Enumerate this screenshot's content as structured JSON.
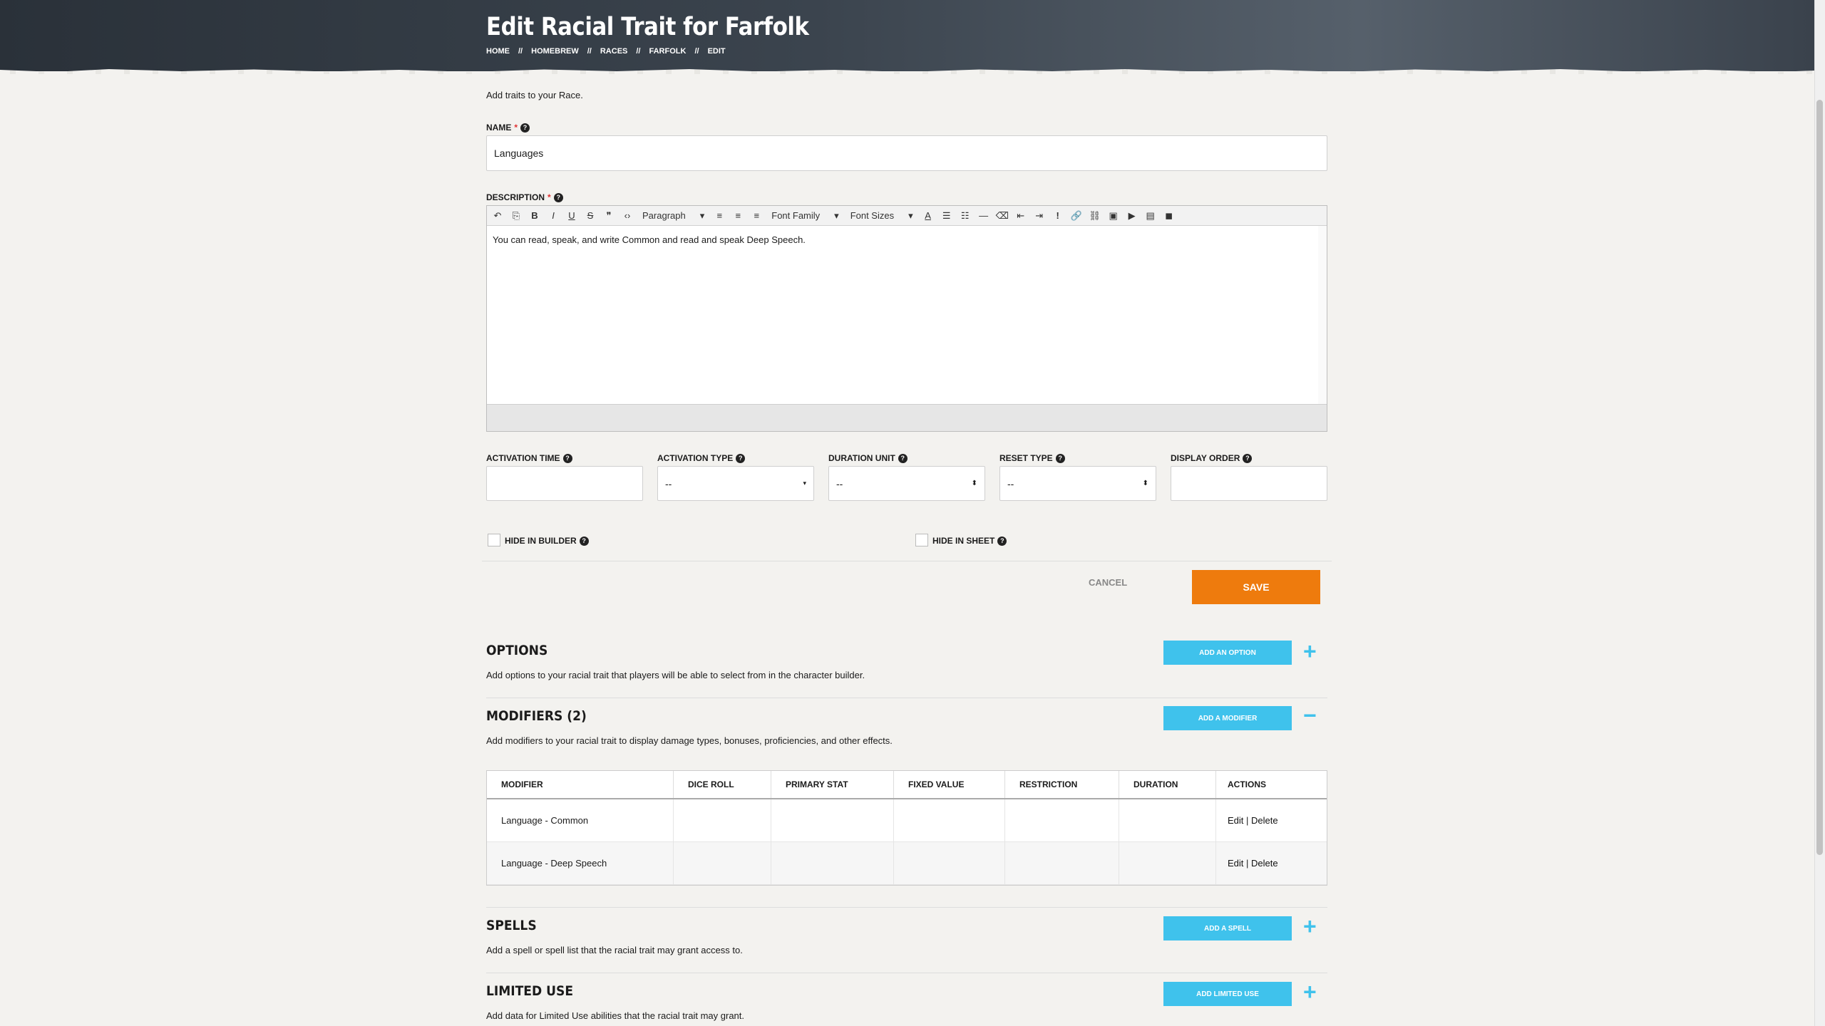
{
  "header": {
    "title": "Edit Racial Trait for Farfolk",
    "breadcrumb": [
      "HOME",
      "//",
      "HOMEBREW",
      "//",
      "RACES",
      "//",
      "FARFOLK",
      "//",
      "EDIT"
    ]
  },
  "intro": "Add traits to your Race.",
  "fields": {
    "name_label": "NAME",
    "name_value": "Languages",
    "description_label": "DESCRIPTION",
    "description_value": "You can read, speak, and write Common and read and speak Deep Speech.",
    "toolbar": {
      "paragraph": "Paragraph",
      "font_family": "Font Family",
      "font_sizes": "Font Sizes"
    },
    "activation_time_label": "ACTIVATION TIME",
    "activation_type_label": "ACTIVATION TYPE",
    "activation_type_value": "--",
    "duration_unit_label": "DURATION UNIT",
    "duration_unit_value": "--",
    "reset_type_label": "RESET TYPE",
    "reset_type_value": "--",
    "display_order_label": "DISPLAY ORDER",
    "hide_in_builder": "HIDE IN BUILDER",
    "hide_in_sheet": "HIDE IN SHEET"
  },
  "actions": {
    "cancel": "CANCEL",
    "save": "SAVE"
  },
  "sections": {
    "options": {
      "title": "OPTIONS",
      "desc": "Add options to your racial trait that players will be able to select from in the character builder.",
      "button": "ADD AN OPTION",
      "toggle": "+"
    },
    "modifiers": {
      "title": "MODIFIERS (2)",
      "desc": "Add modifiers to your racial trait to display damage types, bonuses, proficiencies, and other effects.",
      "button": "ADD A MODIFIER",
      "toggle": "−"
    },
    "spells": {
      "title": "SPELLS",
      "desc": "Add a spell or spell list that the racial trait may grant access to.",
      "button": "ADD A SPELL",
      "toggle": "+"
    },
    "limited_use": {
      "title": "LIMITED USE",
      "desc": "Add data for Limited Use abilities that the racial trait may grant.",
      "button": "ADD LIMITED USE",
      "toggle": "+"
    }
  },
  "modifiers_table": {
    "columns": [
      "MODIFIER",
      "DICE ROLL",
      "PRIMARY STAT",
      "FIXED VALUE",
      "RESTRICTION",
      "DURATION",
      "ACTIONS"
    ],
    "rows": [
      {
        "modifier": "Language - Common",
        "edit": "Edit",
        "sep": " | ",
        "delete": "Delete"
      },
      {
        "modifier": "Language - Deep Speech",
        "edit": "Edit",
        "sep": " | ",
        "delete": "Delete"
      }
    ]
  },
  "colors": {
    "save": "#ee7b0d",
    "accent_blue": "#3fc2ec",
    "header_dark": "#2a3139"
  }
}
